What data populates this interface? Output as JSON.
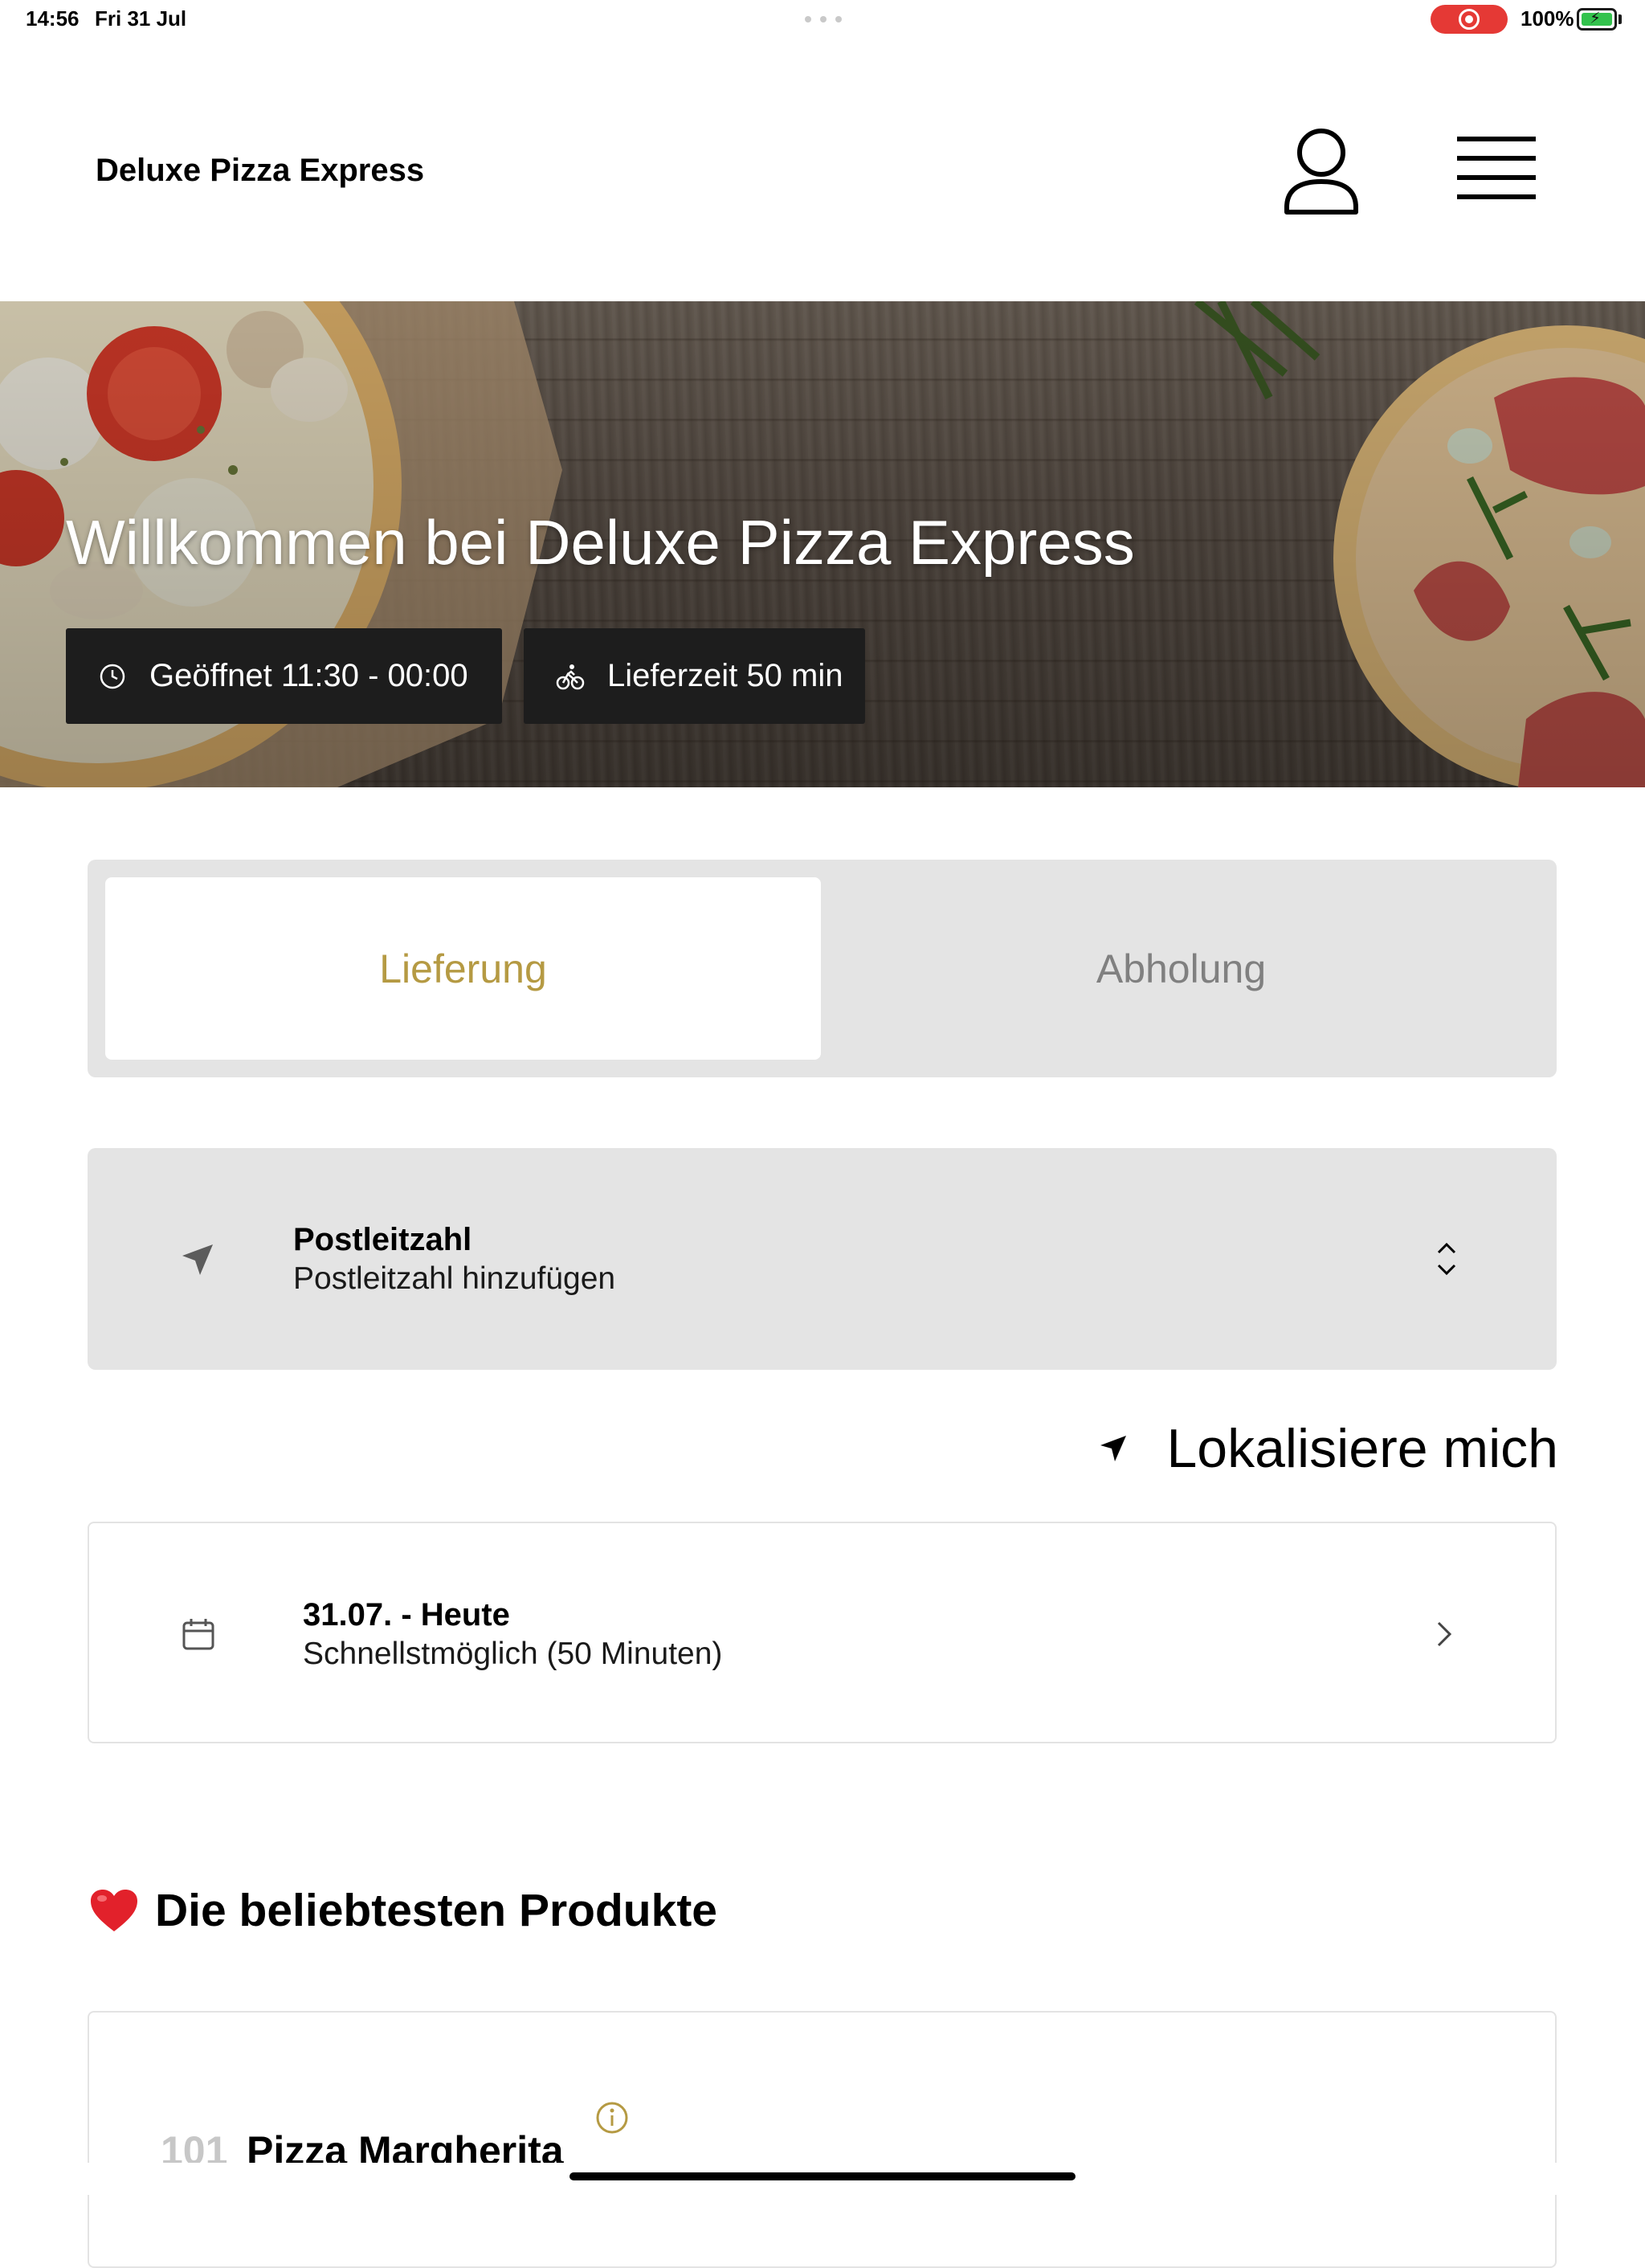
{
  "status_bar": {
    "time": "14:56",
    "date": "Fri 31 Jul",
    "battery_percent": "100%",
    "battery_level": 1.0,
    "colors": {
      "recording": "#e53935",
      "battery": "#33c24d"
    }
  },
  "header": {
    "title": "Deluxe Pizza Express",
    "account_icon": "user-icon",
    "menu_icon": "hamburger-menu-icon"
  },
  "hero": {
    "title": "Willkommen bei Deluxe Pizza Express",
    "opening_hours": "Geöffnet 11:30 - 00:00",
    "opening_icon": "clock-icon",
    "delivery_time": "Lieferzeit 50 min",
    "delivery_icon": "bicycle-icon"
  },
  "order_type": {
    "tabs": [
      {
        "label": "Lieferung",
        "selected": true
      },
      {
        "label": "Abholung",
        "selected": false
      }
    ],
    "accent_color": "#b59a43"
  },
  "postcode": {
    "label": "Postleitzahl",
    "value": "Postleitzahl hinzufügen",
    "icon": "navigation-arrow-icon",
    "control_icon": "chevron-up-down-icon"
  },
  "locate": {
    "label": "Lokalisiere mich",
    "icon": "location-arrow-icon"
  },
  "schedule": {
    "date": "31.07. - Heute",
    "time": "Schnellstmöglich (50 Minuten)",
    "icon": "calendar-icon",
    "chevron": "chevron-right-icon"
  },
  "popular": {
    "heading": "Die beliebtesten Produkte",
    "icon": "heart-icon",
    "products": [
      {
        "number": "101",
        "name": "Pizza Margherita",
        "info_icon": "info-icon"
      }
    ]
  }
}
